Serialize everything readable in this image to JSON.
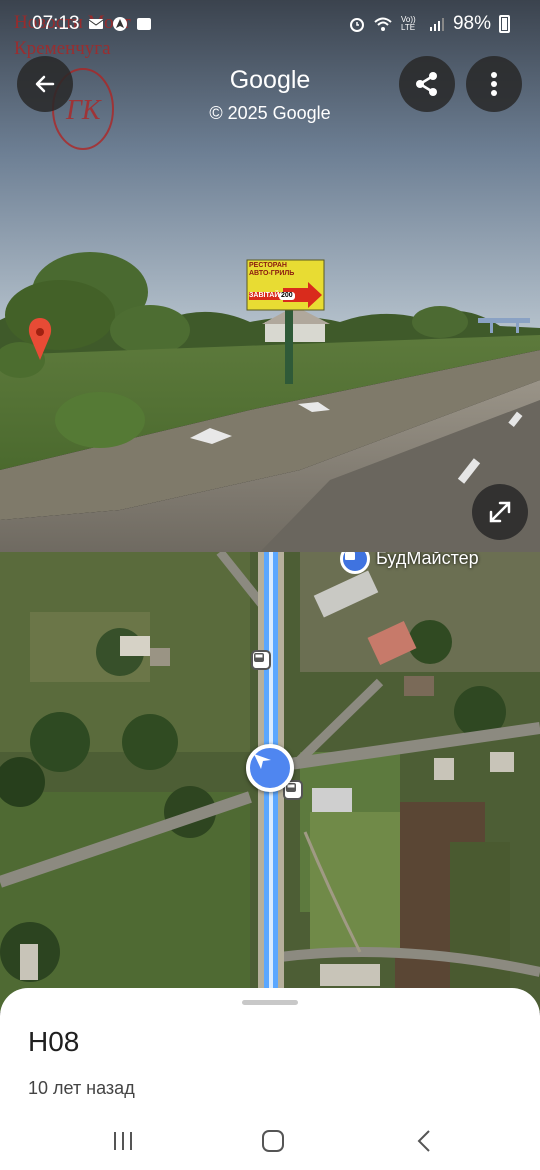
{
  "status_bar": {
    "time": "07:13",
    "battery_text": "98%",
    "network_label": "Vo)) LTE",
    "icons": [
      "mail-icon",
      "gallery-icon",
      "navigation-icon",
      "alarm-icon",
      "wifi-icon",
      "signal-icon",
      "battery-icon"
    ]
  },
  "watermark": {
    "line1": "Новости Мост",
    "line2": "Кременчуга",
    "monogram": "ГК"
  },
  "header": {
    "title": "Google",
    "copyright": "© 2025 Google"
  },
  "billboard": {
    "line1": "РЕСТОРАН",
    "line2": "АВТО-ГРИЛЬ",
    "line3": "ЗАВІТАЙ",
    "sign": "200"
  },
  "map": {
    "poi_label": "БудМайстер"
  },
  "sheet": {
    "title": "Н08",
    "subtitle": "10 лет назад"
  },
  "colors": {
    "route_blue": "#5aa7ff",
    "marker_blue": "#4f86f0",
    "watermark_red": "#b3211f"
  }
}
